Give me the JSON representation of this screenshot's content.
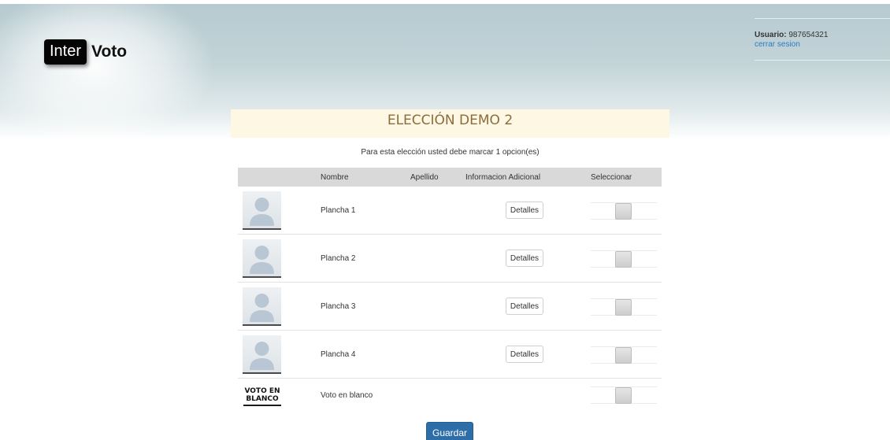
{
  "logo": {
    "box_text": "Inter",
    "text": "Voto"
  },
  "user": {
    "label": "Usuario:",
    "id": "987654321",
    "logout": "cerrar sesion"
  },
  "election": {
    "title": "ELECCIÓN DEMO 2",
    "instruction": "Para esta elección usted debe marcar 1 opcion(es)"
  },
  "table": {
    "headers": {
      "nombre": "Nombre",
      "apellido": "Apellido",
      "info": "Informacion Adicional",
      "select": "Seleccionar"
    },
    "rows": [
      {
        "name": "Plancha 1",
        "details": "Detalles"
      },
      {
        "name": "Plancha 2",
        "details": "Detalles"
      },
      {
        "name": "Plancha 3",
        "details": "Detalles"
      },
      {
        "name": "Plancha 4",
        "details": "Detalles"
      }
    ],
    "blank": {
      "badge_line1": "VOTO EN",
      "badge_line2": "BLANCO",
      "name": "Voto en blanco"
    }
  },
  "save_label": "Guardar",
  "colors": {
    "accent": "#2e6ea8",
    "title_bg": "#fdf7e4",
    "title_text": "#8a6d3b",
    "link": "#2b7bc0"
  }
}
